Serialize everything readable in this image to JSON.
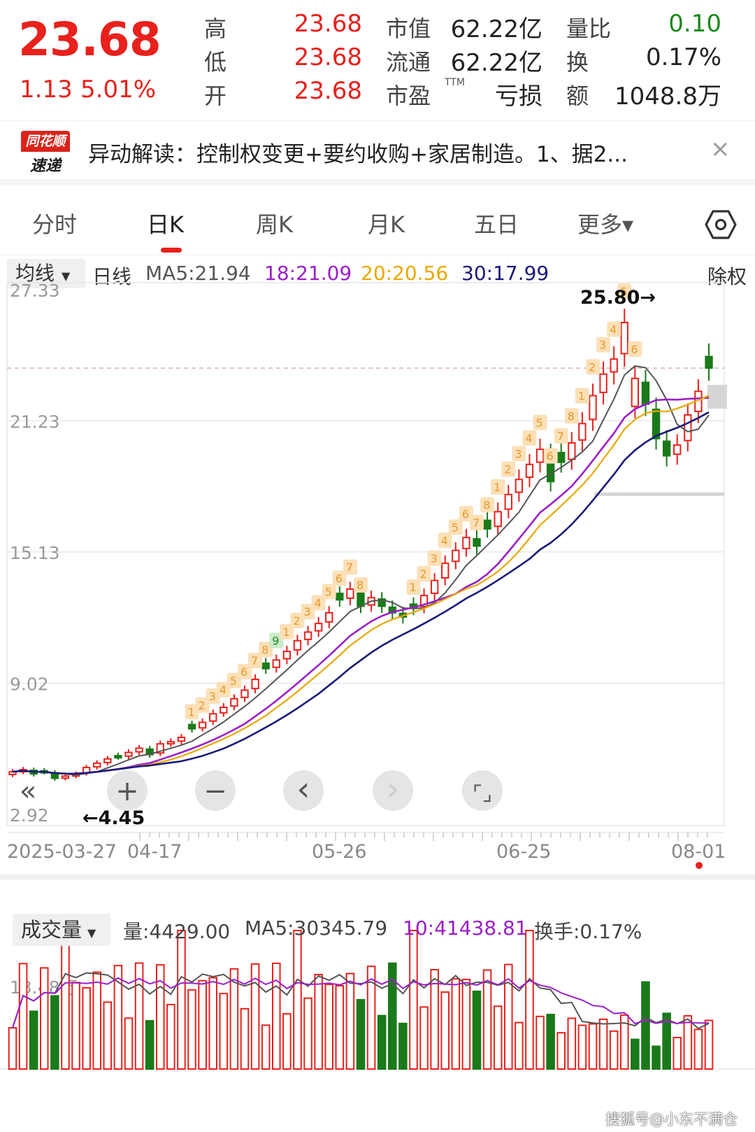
{
  "quote": {
    "price": "23.68",
    "change": "1.13",
    "change_pct": "5.01%",
    "high_label": "高",
    "high": "23.68",
    "low_label": "低",
    "low": "23.68",
    "open_label": "开",
    "open": "23.68",
    "mktcap_label": "市值",
    "mktcap": "62.22亿",
    "float_label": "流通",
    "float": "62.22亿",
    "pe_label": "市盈",
    "pe_ttm": "TTM",
    "pe": "亏损",
    "volratio_label": "量比",
    "volratio": "0.10",
    "turnover_label": "换",
    "turnover": "0.17%",
    "amount_label": "额",
    "amount": "1048.8万"
  },
  "news": {
    "logo_top": "同花顺",
    "logo_bottom": "速递",
    "text": "异动解读：控制权变更+要约收购+家居制造。1、据2...",
    "close": "×"
  },
  "tabs": [
    {
      "label": "分时"
    },
    {
      "label": "日K"
    },
    {
      "label": "周K"
    },
    {
      "label": "月K"
    },
    {
      "label": "五日"
    },
    {
      "label": "更多▾"
    }
  ],
  "ma_bar": {
    "select": "均线",
    "period": "日线",
    "ma5": "MA5:21.94",
    "ma18": "18:21.09",
    "ma20": "20:20.56",
    "ma30": "30:17.99",
    "fuquan": "除权"
  },
  "chart_data": {
    "type": "candlestick",
    "y_ticks": [
      "27.33",
      "21.23",
      "15.13",
      "9.02",
      "2.92"
    ],
    "x_ticks": [
      "2025-03-27",
      "04-17",
      "05-26",
      "06-25",
      "08-01"
    ],
    "high_annotation": "25.80→",
    "low_annotation": "←4.45",
    "ylim": [
      2.92,
      27.33
    ],
    "close_approx": [
      4.9,
      5.0,
      4.8,
      4.9,
      4.6,
      4.7,
      4.8,
      5.1,
      5.3,
      5.5,
      5.6,
      5.8,
      6.0,
      5.7,
      6.2,
      6.3,
      6.5,
      6.9,
      7.2,
      7.6,
      7.9,
      8.3,
      8.7,
      9.2,
      9.7,
      10.1,
      10.5,
      11.0,
      11.4,
      11.8,
      12.3,
      12.9,
      13.4,
      12.6,
      13.0,
      12.6,
      12.3,
      12.1,
      12.5,
      13.1,
      13.8,
      14.6,
      15.2,
      15.8,
      15.4,
      16.2,
      17.0,
      17.8,
      18.5,
      19.2,
      19.9,
      18.4,
      19.3,
      20.2,
      21.1,
      22.4,
      23.4,
      24.1,
      25.8,
      23.2,
      22.0,
      20.4,
      19.6,
      20.1,
      21.5,
      22.6,
      23.68
    ],
    "ma_series": [
      {
        "name": "MA5"
      },
      {
        "name": "18"
      },
      {
        "name": "20"
      },
      {
        "name": "30"
      }
    ]
  },
  "nav_controls": {
    "collapse": "«",
    "zoom_in": "+",
    "zoom_out": "−",
    "prev": "‹",
    "next": "›",
    "fullscreen": "⌜⌟"
  },
  "volume": {
    "select": "成交量",
    "vol_now": "量:4429.00",
    "ma5": "MA5:30345.79",
    "ma10": "10:41438.81",
    "turnover": "换手:0.17%",
    "y_tick": "13.48万"
  },
  "watermark": "搜狐号@小东不满仓",
  "colors": {
    "up": "#e8211c",
    "down": "#1a7a1a",
    "ma5": "#555555",
    "ma18": "#9b1fc8",
    "ma20": "#e8a800",
    "ma30": "#1a1a7a"
  }
}
